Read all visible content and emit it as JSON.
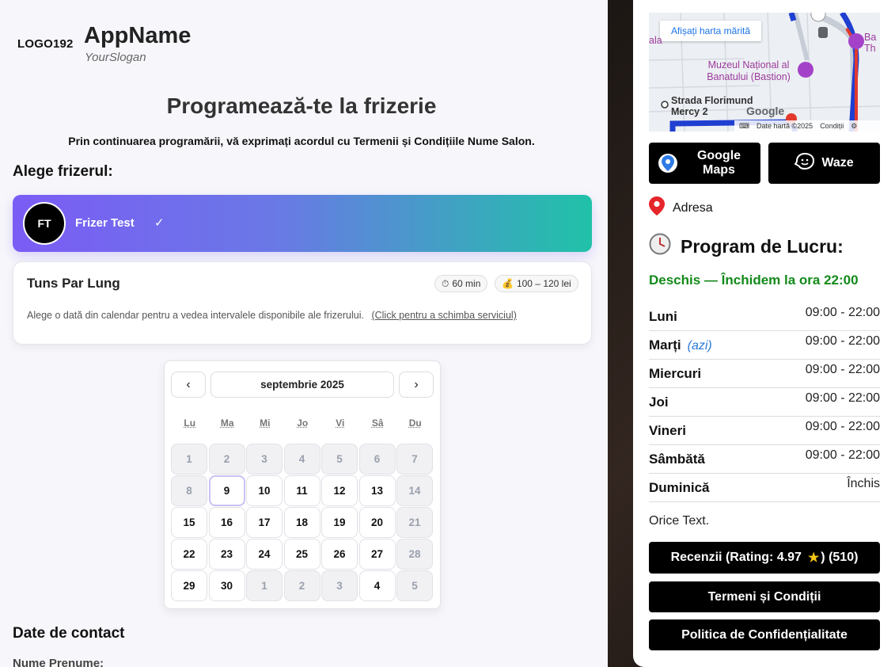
{
  "header": {
    "logo_text": "LOGO192",
    "app_name": "AppName",
    "slogan": "YourSlogan"
  },
  "page": {
    "title": "Programează-te la frizerie",
    "consent_text": "Prin continuarea programării, vă exprimați acordul cu Termenii și Condițiile Nume Salon."
  },
  "barber_section": {
    "heading": "Alege frizerul:",
    "barbers": [
      {
        "initials": "FT",
        "name": "Frizer Test",
        "selected_mark": "✓"
      }
    ]
  },
  "service": {
    "name": "Tuns Par Lung",
    "duration": "60 min",
    "price": "100 – 120 lei",
    "hint": "Alege o dată din calendar pentru a vedea intervalele disponibile ale frizerului.",
    "change_link": "(Click pentru a schimba serviciul)"
  },
  "calendar": {
    "prev": "‹",
    "next": "›",
    "month_label": "septembrie 2025",
    "weekdays": [
      "Lu",
      "Ma",
      "Mi",
      "Jo",
      "Vi",
      "Sâ",
      "Du"
    ],
    "days": [
      {
        "d": "1",
        "state": "disabled"
      },
      {
        "d": "2",
        "state": "disabled"
      },
      {
        "d": "3",
        "state": "disabled"
      },
      {
        "d": "4",
        "state": "disabled"
      },
      {
        "d": "5",
        "state": "disabled"
      },
      {
        "d": "6",
        "state": "disabled"
      },
      {
        "d": "7",
        "state": "disabled"
      },
      {
        "d": "8",
        "state": "disabled"
      },
      {
        "d": "9",
        "state": "today"
      },
      {
        "d": "10",
        "state": "available"
      },
      {
        "d": "11",
        "state": "available"
      },
      {
        "d": "12",
        "state": "available"
      },
      {
        "d": "13",
        "state": "available"
      },
      {
        "d": "14",
        "state": "disabled"
      },
      {
        "d": "15",
        "state": "available"
      },
      {
        "d": "16",
        "state": "available"
      },
      {
        "d": "17",
        "state": "available"
      },
      {
        "d": "18",
        "state": "available"
      },
      {
        "d": "19",
        "state": "available"
      },
      {
        "d": "20",
        "state": "available"
      },
      {
        "d": "21",
        "state": "disabled"
      },
      {
        "d": "22",
        "state": "available"
      },
      {
        "d": "23",
        "state": "available"
      },
      {
        "d": "24",
        "state": "available"
      },
      {
        "d": "25",
        "state": "available"
      },
      {
        "d": "26",
        "state": "available"
      },
      {
        "d": "27",
        "state": "available"
      },
      {
        "d": "28",
        "state": "disabled"
      },
      {
        "d": "29",
        "state": "available"
      },
      {
        "d": "30",
        "state": "available"
      },
      {
        "d": "1",
        "state": "disabled"
      },
      {
        "d": "2",
        "state": "disabled"
      },
      {
        "d": "3",
        "state": "disabled"
      },
      {
        "d": "4",
        "state": "available"
      },
      {
        "d": "5",
        "state": "disabled"
      }
    ]
  },
  "contact": {
    "heading": "Date de contact",
    "name_label": "Nume Prenume:"
  },
  "map": {
    "enlarge_button": "Afișați harta mărită",
    "poi_museum": "Muzeul Național al Banatului (Bastion)",
    "street": "Strada Florimund Mercy 2",
    "edge_label_left": "ala",
    "edge_label_right": "Ba Th",
    "google": "Google",
    "footer_data": "Date hartă ©2025",
    "footer_terms": "Condiții"
  },
  "navigation": {
    "google_maps": "Google Maps",
    "waze": "Waze"
  },
  "address_label": "Adresa",
  "hours": {
    "title": "Program de Lucru:",
    "status": "Deschis — Închidem la ora 22:00",
    "today_tag": "(azi)",
    "rows": [
      {
        "day": "Luni",
        "time": "09:00 - 22:00"
      },
      {
        "day": "Marți",
        "time": "09:00 - 22:00"
      },
      {
        "day": "Miercuri",
        "time": "09:00 - 22:00"
      },
      {
        "day": "Joi",
        "time": "09:00 - 22:00"
      },
      {
        "day": "Vineri",
        "time": "09:00 - 22:00"
      },
      {
        "day": "Sâmbătă",
        "time": "09:00 - 22:00"
      },
      {
        "day": "Duminică",
        "time": "Închis"
      }
    ]
  },
  "note": "Orice Text.",
  "buttons": {
    "reviews_prefix": "Recenzii (Rating: 4.97",
    "reviews_suffix": ") (510)",
    "terms": "Termeni și Condiții",
    "privacy": "Politica de Confidențialitate"
  },
  "colors": {
    "accent_purple": "#7b5cf5",
    "accent_teal": "#20c2a8",
    "open_green": "#138a1a",
    "link_blue": "#2a7ad6"
  }
}
